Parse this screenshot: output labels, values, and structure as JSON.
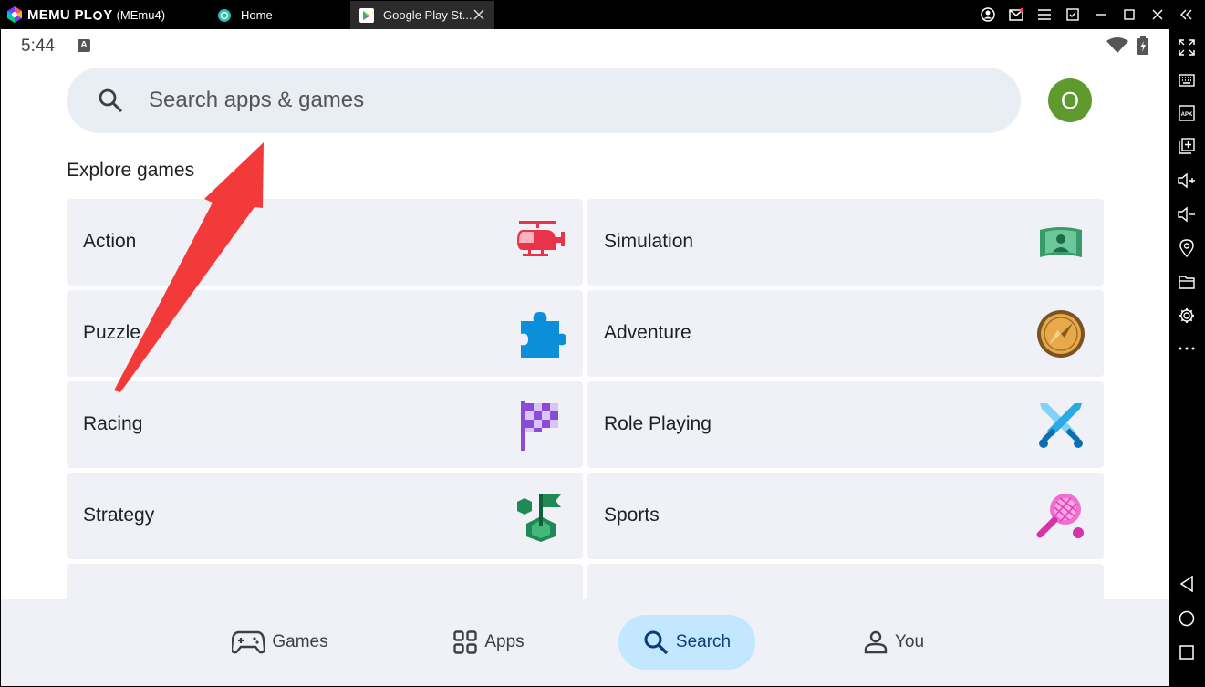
{
  "window": {
    "brand": "MEMU PL",
    "brand_suffix": "Y",
    "instance": "(MEmu4)",
    "tabs": [
      {
        "label": "Home"
      },
      {
        "label": "Google Play St..."
      }
    ]
  },
  "status": {
    "time": "5:44",
    "badge": "A"
  },
  "search": {
    "placeholder": "Search apps & games"
  },
  "account": {
    "initial": "O",
    "color": "#5f9a2e"
  },
  "explore": {
    "title": "Explore games",
    "categories": [
      {
        "label": "Action",
        "icon": "helicopter-icon"
      },
      {
        "label": "Simulation",
        "icon": "vr-user-icon"
      },
      {
        "label": "Puzzle",
        "icon": "puzzle-piece-icon"
      },
      {
        "label": "Adventure",
        "icon": "compass-icon"
      },
      {
        "label": "Racing",
        "icon": "checkered-flag-icon"
      },
      {
        "label": "Role Playing",
        "icon": "crossed-swords-icon"
      },
      {
        "label": "Strategy",
        "icon": "strategy-flag-icon"
      },
      {
        "label": "Sports",
        "icon": "tennis-racket-icon"
      }
    ]
  },
  "bottom_nav": {
    "items": [
      {
        "label": "Games",
        "icon": "gamepad-icon"
      },
      {
        "label": "Apps",
        "icon": "apps-grid-icon"
      },
      {
        "label": "Search",
        "icon": "search-icon",
        "active": true
      },
      {
        "label": "You",
        "icon": "person-icon"
      }
    ]
  },
  "colors": {
    "accent": "#c2e7ff",
    "annotation_arrow": "#f23a3a"
  }
}
